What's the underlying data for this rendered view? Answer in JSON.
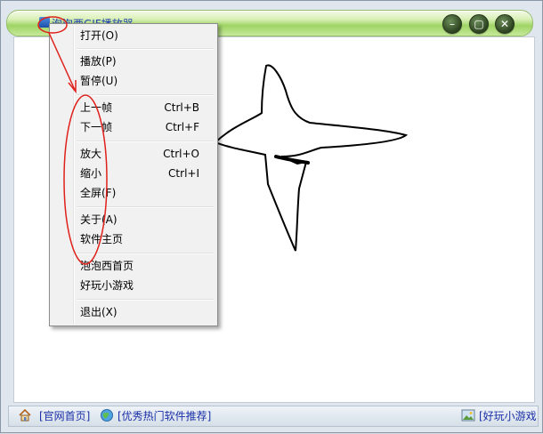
{
  "window": {
    "title": "泡泡西GIF播放器",
    "controls": [
      "minimize",
      "restore",
      "close"
    ]
  },
  "context_menu": {
    "items": [
      {
        "label": "打开(O)",
        "shortcut": ""
      },
      {
        "label": "播放(P)",
        "shortcut": ""
      },
      {
        "label": "暂停(U)",
        "shortcut": ""
      },
      {
        "label": "上一帧",
        "shortcut": "Ctrl+B"
      },
      {
        "label": "下一帧",
        "shortcut": "Ctrl+F"
      },
      {
        "label": "放大",
        "shortcut": "Ctrl+O"
      },
      {
        "label": "缩小",
        "shortcut": "Ctrl+I"
      },
      {
        "label": "全屏(F)",
        "shortcut": ""
      },
      {
        "label": "关于(A)",
        "shortcut": ""
      },
      {
        "label": "软件主页",
        "shortcut": ""
      },
      {
        "label": "泡泡西首页",
        "shortcut": ""
      },
      {
        "label": "好玩小游戏",
        "shortcut": ""
      },
      {
        "label": "退出(X)",
        "shortcut": ""
      }
    ]
  },
  "statusbar": {
    "home_link": "[官网首页]",
    "recommend_link": "[优秀热门软件推荐]",
    "games_link": "[好玩小游戏"
  },
  "annotation": {
    "color": "#e0201a"
  },
  "icons": {
    "home": "home-icon",
    "globe": "globe-icon",
    "picture": "picture-icon",
    "app": "app-icon"
  }
}
